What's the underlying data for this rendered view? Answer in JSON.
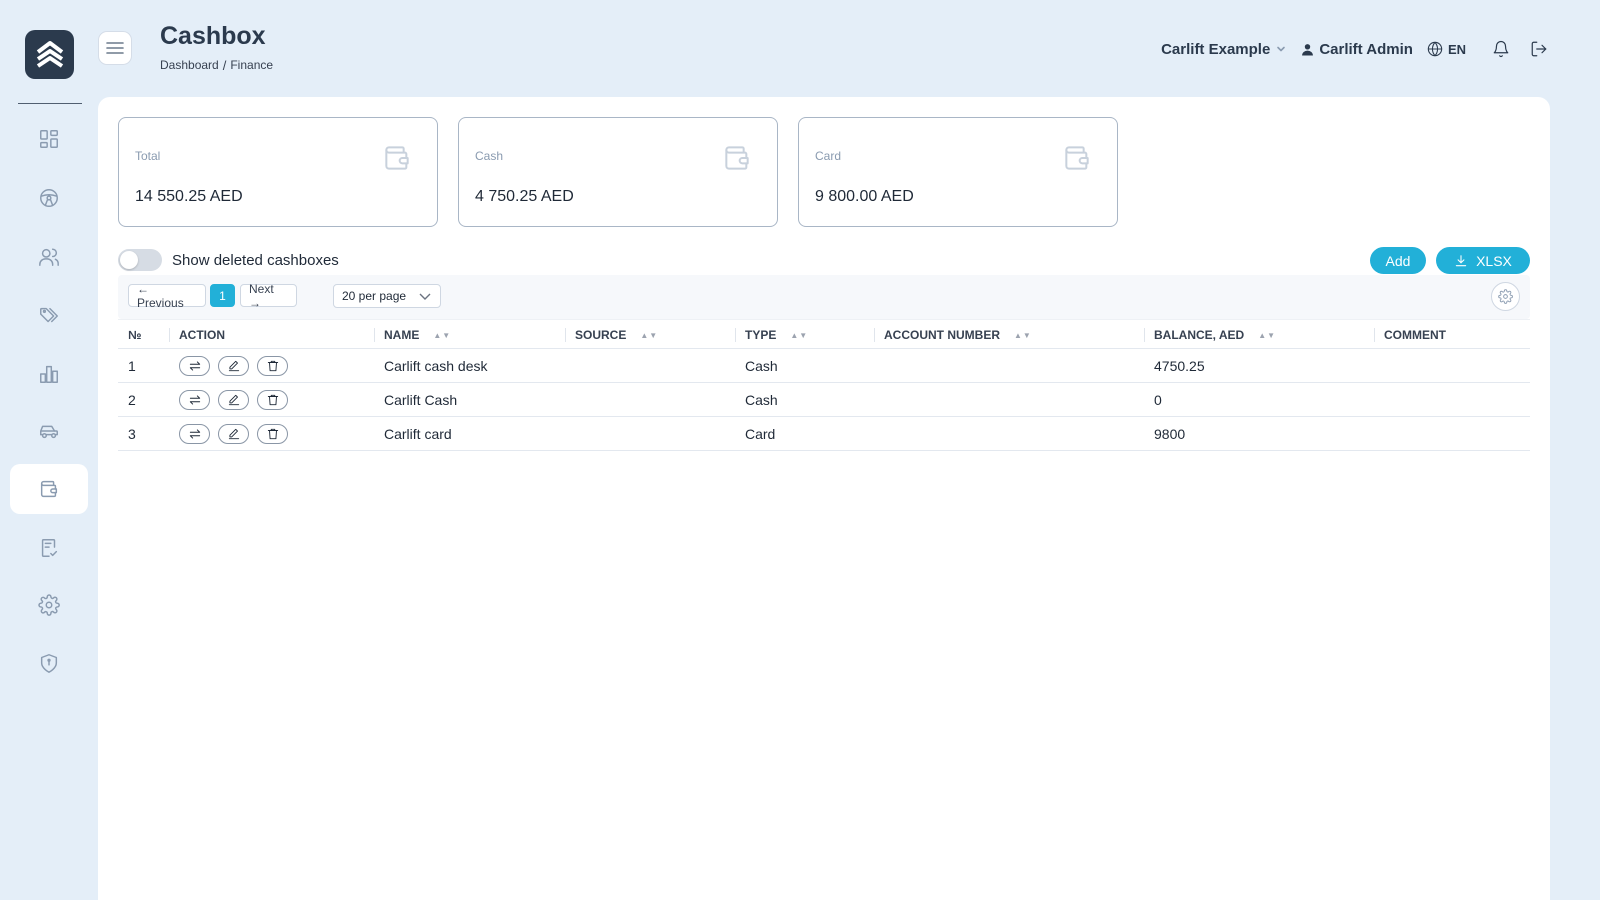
{
  "header": {
    "title": "Cashbox",
    "breadcrumb": [
      "Dashboard",
      "Finance"
    ],
    "breadcrumb_sep": "/",
    "company": "Carlift Example",
    "user": "Carlift Admin",
    "language": "EN"
  },
  "sidebar": {
    "items": [
      {
        "icon": "dashboard-icon"
      },
      {
        "icon": "steering-wheel-icon"
      },
      {
        "icon": "users-icon"
      },
      {
        "icon": "tags-icon"
      },
      {
        "icon": "bar-chart-icon"
      },
      {
        "icon": "car-icon"
      },
      {
        "icon": "wallet-icon",
        "active": true
      },
      {
        "icon": "checklist-icon"
      },
      {
        "icon": "gear-icon"
      },
      {
        "icon": "shield-icon"
      }
    ]
  },
  "stats": [
    {
      "label": "Total",
      "value": "14 550.25 AED"
    },
    {
      "label": "Cash",
      "value": "4 750.25 AED"
    },
    {
      "label": "Card",
      "value": "9 800.00 AED"
    }
  ],
  "controls": {
    "toggle_label": "Show deleted cashboxes",
    "add_label": "Add",
    "export_label": "XLSX",
    "prev_label": "← Previous",
    "next_label": "Next →",
    "current_page": "1",
    "per_page": "20 per page"
  },
  "colors": {
    "accent": "#22b0d8",
    "sidebar_dark": "#2b3a4d",
    "background": "#e4eef8"
  },
  "table": {
    "columns": [
      "№",
      "ACTION",
      "NAME",
      "SOURCE",
      "TYPE",
      "ACCOUNT NUMBER",
      "BALANCE, AED",
      "COMMENT"
    ],
    "rows": [
      {
        "no": "1",
        "name": "Carlift cash desk",
        "source": "",
        "type": "Cash",
        "account": "",
        "balance": "4750.25",
        "comment": ""
      },
      {
        "no": "2",
        "name": "Carlift Cash",
        "source": "",
        "type": "Cash",
        "account": "",
        "balance": "0",
        "comment": ""
      },
      {
        "no": "3",
        "name": "Carlift card",
        "source": "",
        "type": "Card",
        "account": "",
        "balance": "9800",
        "comment": ""
      }
    ]
  }
}
